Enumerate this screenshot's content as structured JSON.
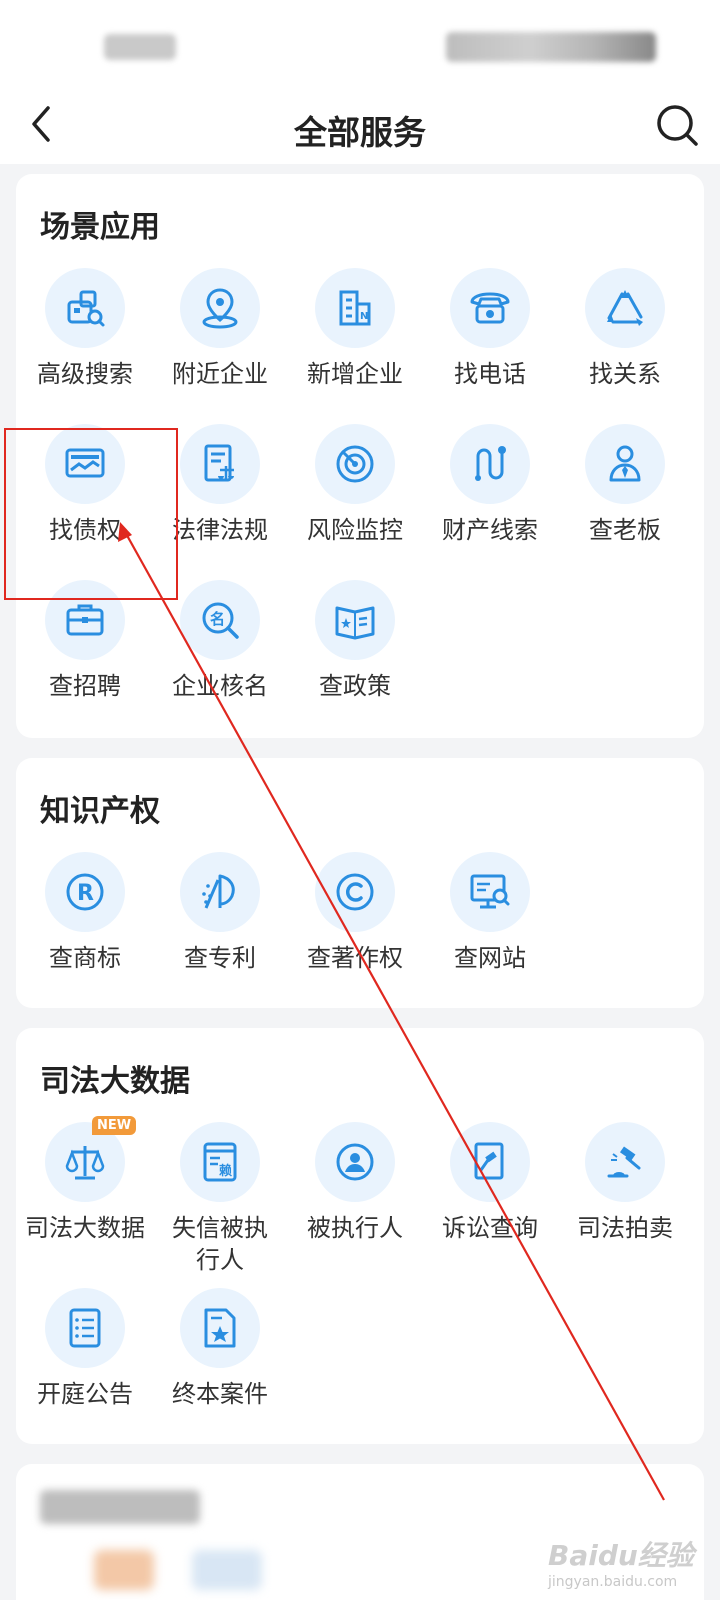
{
  "nav": {
    "title": "全部服务"
  },
  "sections": {
    "scene": {
      "title": "场景应用",
      "items": [
        {
          "label": "高级搜索",
          "icon": "advanced-search-icon"
        },
        {
          "label": "附近企业",
          "icon": "location-pin-icon"
        },
        {
          "label": "新增企业",
          "icon": "building-icon"
        },
        {
          "label": "找电话",
          "icon": "telephone-icon"
        },
        {
          "label": "找关系",
          "icon": "relation-triangle-icon"
        },
        {
          "label": "找债权",
          "icon": "debt-card-icon"
        },
        {
          "label": "法律法规",
          "icon": "law-document-icon"
        },
        {
          "label": "风险监控",
          "icon": "radar-icon"
        },
        {
          "label": "财产线索",
          "icon": "clue-path-icon"
        },
        {
          "label": "查老板",
          "icon": "boss-person-icon"
        },
        {
          "label": "查招聘",
          "icon": "briefcase-icon"
        },
        {
          "label": "企业核名",
          "icon": "name-search-icon"
        },
        {
          "label": "查政策",
          "icon": "policy-book-icon"
        }
      ]
    },
    "ip": {
      "title": "知识产权",
      "items": [
        {
          "label": "查商标",
          "icon": "trademark-icon"
        },
        {
          "label": "查专利",
          "icon": "patent-icon"
        },
        {
          "label": "查著作权",
          "icon": "copyright-icon"
        },
        {
          "label": "查网站",
          "icon": "website-search-icon"
        }
      ]
    },
    "judicial": {
      "title": "司法大数据",
      "badge": "NEW",
      "items": [
        {
          "label": "司法大数据",
          "icon": "scales-icon"
        },
        {
          "label": "失信被执\n行人",
          "icon": "dishonest-document-icon"
        },
        {
          "label": "被执行人",
          "icon": "executed-person-icon"
        },
        {
          "label": "诉讼查询",
          "icon": "lawsuit-hammer-icon"
        },
        {
          "label": "司法拍卖",
          "icon": "auction-gavel-icon"
        },
        {
          "label": "开庭公告",
          "icon": "announcement-list-icon"
        },
        {
          "label": "终本案件",
          "icon": "closed-case-icon"
        }
      ]
    }
  },
  "watermark": {
    "logo": "Baidu经验",
    "url": "jingyan.baidu.com"
  },
  "colors": {
    "accent": "#2a8ee0",
    "icon_bg": "#e9f3fd",
    "highlight": "#e0281f",
    "badge": "#f29a3a"
  }
}
